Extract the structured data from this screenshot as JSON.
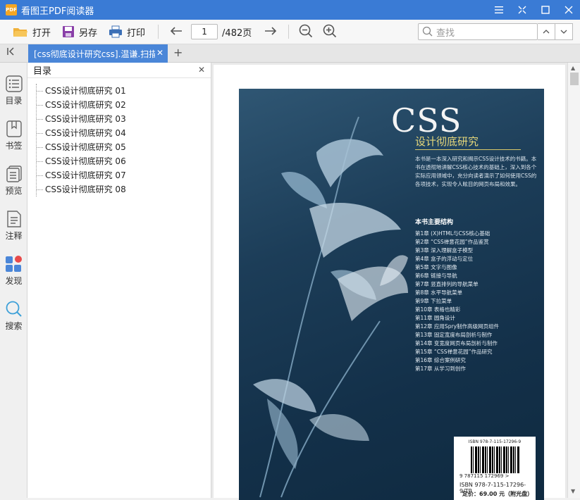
{
  "app": {
    "title": "看图王PDF阅读器",
    "logo_text": "PDF"
  },
  "window_controls": [
    "menu-icon",
    "restore-icon",
    "maximize-icon",
    "close-icon"
  ],
  "toolbar": {
    "open_label": "打开",
    "saveas_label": "另存",
    "print_label": "打印",
    "current_page": "1",
    "total_pages": "/482页",
    "search_placeholder": "查找"
  },
  "tab": {
    "label": "[css彻底设计研究css].温谦.扫描"
  },
  "leftbar": {
    "items": [
      {
        "label": "目录",
        "icon": "toc-icon"
      },
      {
        "label": "书签",
        "icon": "bookmark-icon"
      },
      {
        "label": "预览",
        "icon": "thumbnail-icon"
      },
      {
        "label": "注释",
        "icon": "annotation-icon"
      },
      {
        "label": "发现",
        "icon": "discover-icon"
      },
      {
        "label": "搜索",
        "icon": "search-icon"
      }
    ]
  },
  "toc": {
    "title": "目录",
    "items": [
      "CSS设计彻底研究 01",
      "CSS设计彻底研究 02",
      "CSS设计彻底研究 03",
      "CSS设计彻底研究 04",
      "CSS设计彻底研究 05",
      "CSS设计彻底研究 06",
      "CSS设计彻底研究 07",
      "CSS设计彻底研究 08"
    ]
  },
  "cover": {
    "title": "CSS",
    "subtitle": "设计彻底研究",
    "description": "本书是一本深入研究和揭示CSS设计技术的书籍。本书在透彻地讲解CSS核心技术的基础上，深入到各个实际应用领域中，充分向读者演示了如何使用CSS的各项技术，实现令人眩目的网页布局和效果。",
    "structure_heading": "本书主要结构",
    "chapters": [
      "第1章 (X)HTML与CSS核心基础",
      "第2章 “CSS禅意花园”作品鉴赏",
      "第3章 深入理解盒子模型",
      "第4章 盒子的浮动与定位",
      "第5章 文字与图像",
      "第6章 链接与导航",
      "第7章 竖直排列的导航菜单",
      "第8章 水平导航菜单",
      "第9章 下拉菜单",
      "第10章 表格也精彩",
      "第11章 圆角设计",
      "第12章 应用Spry制作高级网页组件",
      "第13章 固定宽度布局剖析与制作",
      "第14章 变宽度网页布局剖析与制作",
      "第15章 “CSS禅意花园”作品研究",
      "第16章 综合案例研究",
      "第17章 从学习到创作"
    ],
    "isbn_top": "ISBN 978-7-115-17296-9",
    "barcode_number": "9 787115 172969 >",
    "isbn": "ISBN 978-7-115-17296-9/TP",
    "price": "定价：69.00 元（附光盘）"
  }
}
